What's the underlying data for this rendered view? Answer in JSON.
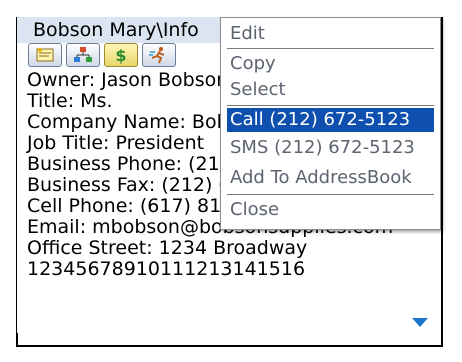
{
  "contact": {
    "title_bar": "Bobson Mary\\Info"
  },
  "tabs": [
    {
      "icon": "contact-card-icon"
    },
    {
      "icon": "org-chart-icon"
    },
    {
      "icon": "dollar-icon"
    },
    {
      "icon": "runner-icon"
    }
  ],
  "fields": [
    "Owner: Jason Bobson",
    "Title: Ms.",
    "Company Name: Bobson Supplies",
    "Job Title: President",
    "Business Phone: (212) 672-5123",
    "Business Fax: (212) 080-9870",
    "Cell Phone: (617) 819-3214",
    "Email: mbobson@bobsonsupplies.com",
    "Office Street: 1234 Broadway",
    "12345678910111213141516"
  ],
  "menu": {
    "items": [
      "Edit",
      "Copy",
      "Select",
      "Call (212) 672-5123",
      "SMS (212) 672-5123",
      "Add To AddressBook",
      "Close"
    ],
    "selected_index": 3
  },
  "colors": {
    "title_bg": "#dbe4f1",
    "menu_highlight": "#0f4fae",
    "menu_text": "#5d6470",
    "scroll_arrow": "#1a77c9"
  }
}
